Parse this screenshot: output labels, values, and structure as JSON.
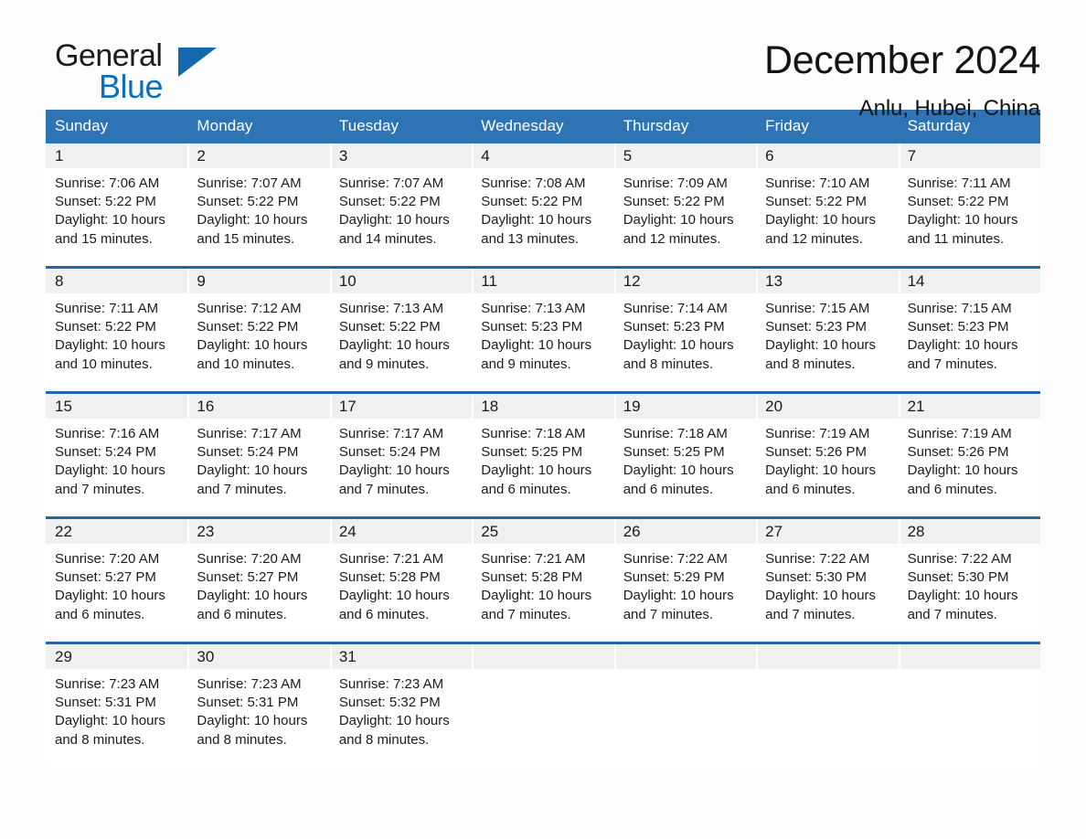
{
  "logo": {
    "word_one": "General",
    "word_two": "Blue",
    "triangle_color": "#1567ae",
    "blue_color": "#0b6fc0"
  },
  "header": {
    "title": "December 2024",
    "subtitle": "Anlu, Hubei, China"
  },
  "theme": {
    "header_blue": "#2e74b5",
    "row_divider_blue": "#2065ad",
    "date_band_gray": "#f0f0f0",
    "page_background": "#fdfdfd"
  },
  "weekdays": [
    "Sunday",
    "Monday",
    "Tuesday",
    "Wednesday",
    "Thursday",
    "Friday",
    "Saturday"
  ],
  "weeks": [
    [
      {
        "day": "1",
        "info": "Sunrise: 7:06 AM\nSunset: 5:22 PM\nDaylight: 10 hours\nand 15 minutes."
      },
      {
        "day": "2",
        "info": "Sunrise: 7:07 AM\nSunset: 5:22 PM\nDaylight: 10 hours\nand 15 minutes."
      },
      {
        "day": "3",
        "info": "Sunrise: 7:07 AM\nSunset: 5:22 PM\nDaylight: 10 hours\nand 14 minutes."
      },
      {
        "day": "4",
        "info": "Sunrise: 7:08 AM\nSunset: 5:22 PM\nDaylight: 10 hours\nand 13 minutes."
      },
      {
        "day": "5",
        "info": "Sunrise: 7:09 AM\nSunset: 5:22 PM\nDaylight: 10 hours\nand 12 minutes."
      },
      {
        "day": "6",
        "info": "Sunrise: 7:10 AM\nSunset: 5:22 PM\nDaylight: 10 hours\nand 12 minutes."
      },
      {
        "day": "7",
        "info": "Sunrise: 7:11 AM\nSunset: 5:22 PM\nDaylight: 10 hours\nand 11 minutes."
      }
    ],
    [
      {
        "day": "8",
        "info": "Sunrise: 7:11 AM\nSunset: 5:22 PM\nDaylight: 10 hours\nand 10 minutes."
      },
      {
        "day": "9",
        "info": "Sunrise: 7:12 AM\nSunset: 5:22 PM\nDaylight: 10 hours\nand 10 minutes."
      },
      {
        "day": "10",
        "info": "Sunrise: 7:13 AM\nSunset: 5:22 PM\nDaylight: 10 hours\nand 9 minutes."
      },
      {
        "day": "11",
        "info": "Sunrise: 7:13 AM\nSunset: 5:23 PM\nDaylight: 10 hours\nand 9 minutes."
      },
      {
        "day": "12",
        "info": "Sunrise: 7:14 AM\nSunset: 5:23 PM\nDaylight: 10 hours\nand 8 minutes."
      },
      {
        "day": "13",
        "info": "Sunrise: 7:15 AM\nSunset: 5:23 PM\nDaylight: 10 hours\nand 8 minutes."
      },
      {
        "day": "14",
        "info": "Sunrise: 7:15 AM\nSunset: 5:23 PM\nDaylight: 10 hours\nand 7 minutes."
      }
    ],
    [
      {
        "day": "15",
        "info": "Sunrise: 7:16 AM\nSunset: 5:24 PM\nDaylight: 10 hours\nand 7 minutes."
      },
      {
        "day": "16",
        "info": "Sunrise: 7:17 AM\nSunset: 5:24 PM\nDaylight: 10 hours\nand 7 minutes."
      },
      {
        "day": "17",
        "info": "Sunrise: 7:17 AM\nSunset: 5:24 PM\nDaylight: 10 hours\nand 7 minutes."
      },
      {
        "day": "18",
        "info": "Sunrise: 7:18 AM\nSunset: 5:25 PM\nDaylight: 10 hours\nand 6 minutes."
      },
      {
        "day": "19",
        "info": "Sunrise: 7:18 AM\nSunset: 5:25 PM\nDaylight: 10 hours\nand 6 minutes."
      },
      {
        "day": "20",
        "info": "Sunrise: 7:19 AM\nSunset: 5:26 PM\nDaylight: 10 hours\nand 6 minutes."
      },
      {
        "day": "21",
        "info": "Sunrise: 7:19 AM\nSunset: 5:26 PM\nDaylight: 10 hours\nand 6 minutes."
      }
    ],
    [
      {
        "day": "22",
        "info": "Sunrise: 7:20 AM\nSunset: 5:27 PM\nDaylight: 10 hours\nand 6 minutes."
      },
      {
        "day": "23",
        "info": "Sunrise: 7:20 AM\nSunset: 5:27 PM\nDaylight: 10 hours\nand 6 minutes."
      },
      {
        "day": "24",
        "info": "Sunrise: 7:21 AM\nSunset: 5:28 PM\nDaylight: 10 hours\nand 6 minutes."
      },
      {
        "day": "25",
        "info": "Sunrise: 7:21 AM\nSunset: 5:28 PM\nDaylight: 10 hours\nand 7 minutes."
      },
      {
        "day": "26",
        "info": "Sunrise: 7:22 AM\nSunset: 5:29 PM\nDaylight: 10 hours\nand 7 minutes."
      },
      {
        "day": "27",
        "info": "Sunrise: 7:22 AM\nSunset: 5:30 PM\nDaylight: 10 hours\nand 7 minutes."
      },
      {
        "day": "28",
        "info": "Sunrise: 7:22 AM\nSunset: 5:30 PM\nDaylight: 10 hours\nand 7 minutes."
      }
    ],
    [
      {
        "day": "29",
        "info": "Sunrise: 7:23 AM\nSunset: 5:31 PM\nDaylight: 10 hours\nand 8 minutes."
      },
      {
        "day": "30",
        "info": "Sunrise: 7:23 AM\nSunset: 5:31 PM\nDaylight: 10 hours\nand 8 minutes."
      },
      {
        "day": "31",
        "info": "Sunrise: 7:23 AM\nSunset: 5:32 PM\nDaylight: 10 hours\nand 8 minutes."
      },
      {
        "day": "",
        "info": ""
      },
      {
        "day": "",
        "info": ""
      },
      {
        "day": "",
        "info": ""
      },
      {
        "day": "",
        "info": ""
      }
    ]
  ]
}
